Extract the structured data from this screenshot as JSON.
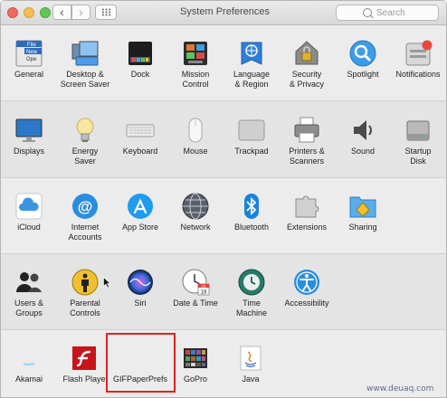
{
  "window": {
    "title": "System Preferences"
  },
  "search": {
    "placeholder": "Search"
  },
  "rows": [
    [
      {
        "label": "General",
        "icon": "general-icon"
      },
      {
        "label": "Desktop &\nScreen Saver",
        "icon": "desktop-screensaver-icon"
      },
      {
        "label": "Dock",
        "icon": "dock-icon"
      },
      {
        "label": "Mission\nControl",
        "icon": "mission-control-icon"
      },
      {
        "label": "Language\n& Region",
        "icon": "language-region-icon"
      },
      {
        "label": "Security\n& Privacy",
        "icon": "security-privacy-icon"
      },
      {
        "label": "Spotlight",
        "icon": "spotlight-icon"
      },
      {
        "label": "Notifications",
        "icon": "notifications-icon"
      }
    ],
    [
      {
        "label": "Displays",
        "icon": "displays-icon"
      },
      {
        "label": "Energy\nSaver",
        "icon": "energy-saver-icon"
      },
      {
        "label": "Keyboard",
        "icon": "keyboard-icon"
      },
      {
        "label": "Mouse",
        "icon": "mouse-icon"
      },
      {
        "label": "Trackpad",
        "icon": "trackpad-icon"
      },
      {
        "label": "Printers &\nScanners",
        "icon": "printers-scanners-icon"
      },
      {
        "label": "Sound",
        "icon": "sound-icon"
      },
      {
        "label": "Startup\nDisk",
        "icon": "startup-disk-icon"
      }
    ],
    [
      {
        "label": "iCloud",
        "icon": "icloud-icon"
      },
      {
        "label": "Internet\nAccounts",
        "icon": "internet-accounts-icon"
      },
      {
        "label": "App Store",
        "icon": "app-store-icon"
      },
      {
        "label": "Network",
        "icon": "network-icon"
      },
      {
        "label": "Bluetooth",
        "icon": "bluetooth-icon"
      },
      {
        "label": "Extensions",
        "icon": "extensions-icon"
      },
      {
        "label": "Sharing",
        "icon": "sharing-icon"
      }
    ],
    [
      {
        "label": "Users &\nGroups",
        "icon": "users-groups-icon"
      },
      {
        "label": "Parental\nControls",
        "icon": "parental-controls-icon"
      },
      {
        "label": "Siri",
        "icon": "siri-icon"
      },
      {
        "label": "Date & Time",
        "icon": "date-time-icon"
      },
      {
        "label": "Time\nMachine",
        "icon": "time-machine-icon"
      },
      {
        "label": "Accessibility",
        "icon": "accessibility-icon"
      }
    ],
    [
      {
        "label": "Akamai",
        "icon": "akamai-icon"
      },
      {
        "label": "Flash Playe",
        "icon": "flash-player-icon"
      },
      {
        "label": "GIFPaperPrefs",
        "icon": "gifpaperprefs-icon"
      },
      {
        "label": "GoPro",
        "icon": "gopro-icon"
      },
      {
        "label": "Java",
        "icon": "java-icon"
      }
    ]
  ],
  "icon_text": {
    "general_file": "File",
    "general_new": "New",
    "general_open": "Ope",
    "date_month": "JUL",
    "date_day": "18"
  },
  "watermark": "www.deuaq.com"
}
